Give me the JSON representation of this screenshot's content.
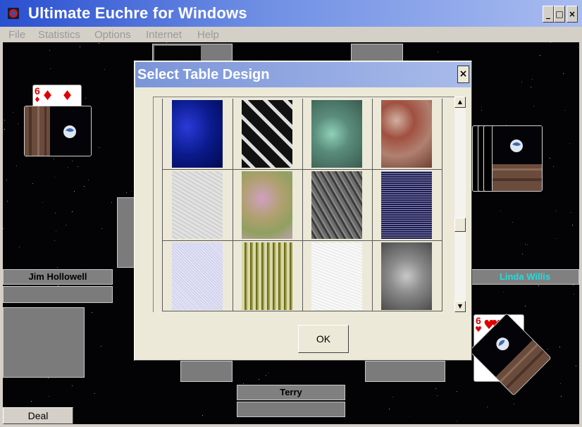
{
  "window": {
    "title": "Ultimate Euchre for Windows"
  },
  "menu": [
    "File",
    "Statistics",
    "Options",
    "Internet",
    "Help"
  ],
  "window_buttons": {
    "minimize": "_",
    "maximize": "□",
    "close": "×"
  },
  "dialog": {
    "title": "Select Table Design",
    "close_label": "×",
    "ok_label": "OK",
    "designs": [
      {
        "name": "blue-marble",
        "color": "#0a1a8a"
      },
      {
        "name": "houndstooth",
        "color": "#111111"
      },
      {
        "name": "teal-stone",
        "color": "#5a8c7c"
      },
      {
        "name": "red-granite",
        "color": "#b08070"
      },
      {
        "name": "white-texture",
        "color": "#e2e2e2"
      },
      {
        "name": "pastel-marble",
        "color": "#b0a070"
      },
      {
        "name": "gray-stone",
        "color": "#6c6c6c"
      },
      {
        "name": "navy-speckle",
        "color": "#1c1c4c"
      },
      {
        "name": "lavender-speckle",
        "color": "#e4e4f6"
      },
      {
        "name": "olive-stripes",
        "color": "#8c8c3c"
      },
      {
        "name": "white-speckle",
        "color": "#f8f8f8"
      },
      {
        "name": "gray-marble",
        "color": "#8c8c8c"
      }
    ]
  },
  "players": {
    "west": "Jim Hollowell",
    "east": "Linda Willis",
    "south": "Terry"
  },
  "cards": {
    "west_card_rank": "6",
    "west_card_suit": "♦",
    "east_card_rank": "6",
    "east_card_suit": "♥",
    "east_card_corner": "9"
  },
  "deal_label": "Deal",
  "colors": {
    "east_name": "#22dddd",
    "card_red": "#e00000"
  }
}
